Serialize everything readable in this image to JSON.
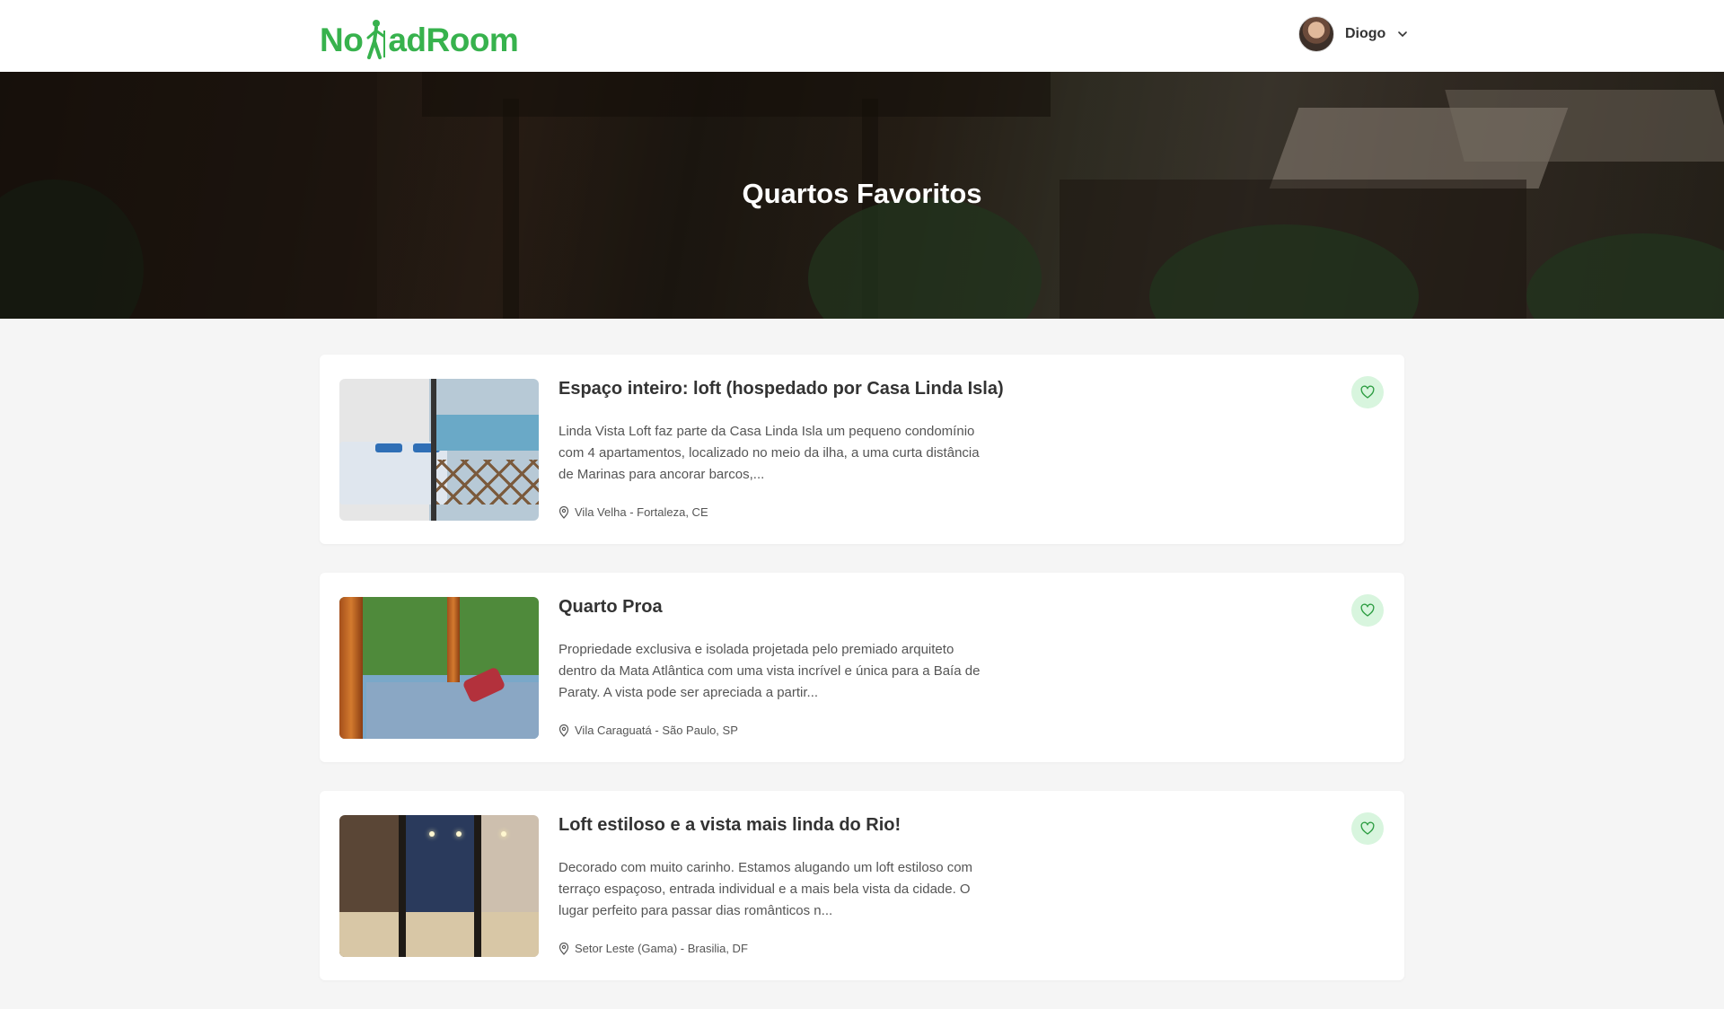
{
  "header": {
    "logo_text_left": "No",
    "logo_text_right": "adRoom",
    "user_name": "Diogo"
  },
  "hero": {
    "title": "Quartos Favoritos"
  },
  "rooms": [
    {
      "title": "Espaço inteiro: loft (hospedado por Casa Linda Isla)",
      "description": "Linda Vista Loft faz parte da Casa Linda Isla um pequeno condomínio com 4 apartamentos, localizado no meio da ilha, a uma curta distância de Marinas para ancorar barcos,...",
      "location": "Vila Velha - Fortaleza, CE"
    },
    {
      "title": "Quarto Proa",
      "description": "Propriedade exclusiva e isolada projetada pelo premiado arquiteto dentro da Mata Atlântica com uma vista incrível e única para a Baía de Paraty. A vista pode ser apreciada a partir...",
      "location": "Vila Caraguatá - São Paulo, SP"
    },
    {
      "title": "Loft estiloso e a vista mais linda do Rio!",
      "description": "Decorado com muito carinho. Estamos alugando um loft estiloso com terraço espaçoso, entrada individual e a mais bela vista da cidade. O lugar perfeito para passar dias românticos n...",
      "location": "Setor Leste (Gama) - Brasilia, DF"
    }
  ],
  "icons": {
    "favorite": "heart-icon",
    "location": "map-pin-icon",
    "dropdown": "chevron-down-icon",
    "logo": "hiker-icon"
  },
  "colors": {
    "brand_green": "#37b24d",
    "favorite_bg": "#d8f5de",
    "favorite_stroke": "#2f9e44"
  }
}
